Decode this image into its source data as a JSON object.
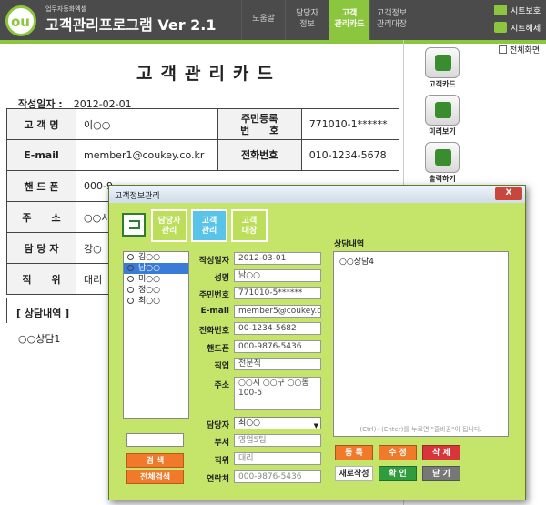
{
  "header": {
    "brand_sub": "업무자동화엑셀",
    "title": "고객관리프로그램 Ver 2.1",
    "tabs": [
      {
        "label": "도움말"
      },
      {
        "label": "담당자\n정보"
      },
      {
        "label": "고객\n관리카드"
      },
      {
        "label": "고객정보\n관리대장"
      }
    ],
    "sheet_protect": "시트보호",
    "sheet_unprotect": "시트해제"
  },
  "fullscreen_label": "전체화면",
  "card": {
    "title": "고객관리카드",
    "date_label": "작성일자 :",
    "date_value": "2012-02-01",
    "rows": [
      {
        "l1": "고 객 명",
        "v1": "이○○",
        "l2": "주민등록\n번　　호",
        "v2": "771010-1******"
      },
      {
        "l1": "E-mail",
        "v1": "member1@coukey.co.kr",
        "l2": "전화번호",
        "v2": "010-1234-5678"
      },
      {
        "l1": "핸 드 폰",
        "v1": "000-9",
        "l2": "",
        "v2": ""
      },
      {
        "l1": "주　　소",
        "v1": "○○시",
        "l2": "",
        "v2": ""
      },
      {
        "l1": "담 당 자",
        "v1": "강○",
        "l2": "",
        "v2": ""
      },
      {
        "l1": "직　　위",
        "v1": "대리",
        "l2": "",
        "v2": ""
      }
    ],
    "consult_header": "[ 상담내역 ]",
    "consult_text": "○○상담1"
  },
  "side_buttons": [
    {
      "label": "고객카드"
    },
    {
      "label": "미리보기"
    },
    {
      "label": "출력하기"
    }
  ],
  "dialog": {
    "title": "고객정보관리",
    "close": "X",
    "tabs": [
      "담당자\n관리",
      "고객\n관리",
      "고객\n대장"
    ],
    "list": [
      "김○○",
      "남○○",
      "미○○",
      "정○○",
      "최○○"
    ],
    "search_button": "검 색",
    "search_all_button": "전체검색",
    "fields": {
      "date_label": "작성일자",
      "date": "2012-03-01",
      "name_label": "성명",
      "name": "남○○",
      "id_label": "주민번호",
      "id": "771010-5******",
      "email_label": "E-mail",
      "email": "member5@coukey.co.kr",
      "phone_label": "전화번호",
      "phone": "00-1234-5682",
      "mobile_label": "핸드폰",
      "mobile": "000-9876-5436",
      "job_label": "직업",
      "job": "전문직",
      "addr_label": "주소",
      "addr": "○○시 ○○구 ○○동 100-5",
      "mgr_label": "담당자",
      "mgr": "최○○",
      "dept_label": "부서",
      "dept": "영업5팀",
      "pos_label": "직위",
      "pos": "대리",
      "contact_label": "연락처",
      "contact": "000-9876-5436"
    },
    "consult_label": "상담내역",
    "consult_text": "○○상담4",
    "hint": "(Ctrl)+(Enter)를 누르면 \"줄바꿈\"이 됩니다.",
    "buttons": {
      "register": "등 록",
      "modify": "수 정",
      "delete": "삭 제",
      "new": "새로작성",
      "confirm": "확 인",
      "close": "닫 기"
    }
  }
}
